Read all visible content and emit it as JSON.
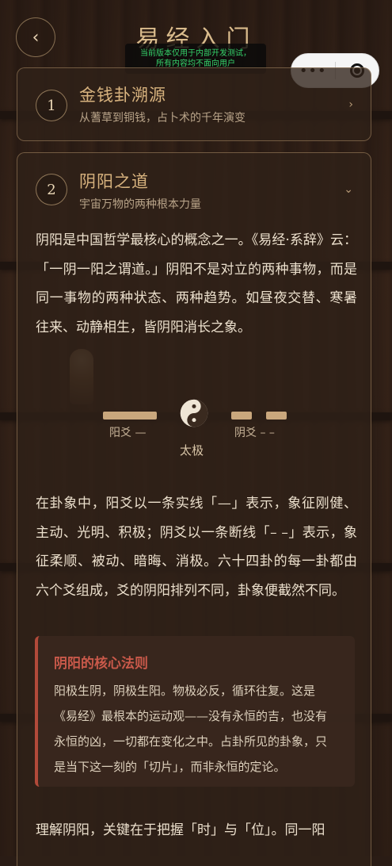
{
  "header": {
    "back_icon": "chevron-left-icon",
    "back_glyph": "‹",
    "title": "易经入门",
    "dev_tip_line1": "当前版本仅用于内部开发测试，",
    "dev_tip_line2": "所有内容均不面向用户",
    "capsule_more": "•••",
    "capsule_close_icon": "target-icon"
  },
  "sections": [
    {
      "number": "1",
      "title": "金钱卦溯源",
      "subtitle": "从蓍草到铜钱，占卜术的千年演变",
      "chevron": "›"
    },
    {
      "number": "2",
      "title": "阴阳之道",
      "subtitle": "宇宙万物的两种根本力量",
      "chevron": "⌄"
    }
  ],
  "content": {
    "paragraph1": "阴阳是中国哲学最核心的概念之一。《易经·系辞》云：「一阴一阳之谓道。」阴阳不是对立的两种事物，而是同一事物的两种状态、两种趋势。如昼夜交替、寒暑往来、动静相生，皆阴阳消长之象。",
    "diagram": {
      "yang_label": "阳爻 —",
      "yin_label": "阴爻 – –",
      "taiji_label": "太极"
    },
    "paragraph2": "在卦象中，阳爻以一条实线「—」表示，象征刚健、主动、光明、积极；阴爻以一条断线「– –」表示，象征柔顺、被动、暗晦、消极。六十四卦的每一卦都由六个爻组成，爻的阴阳排列不同，卦象便截然不同。",
    "rule_title": "阴阳的核心法则",
    "rule_text": "阳极生阴，阴极生阳。物极必反，循环往复。这是《易经》最根本的运动观——没有永恒的吉，也没有永恒的凶，一切都在变化之中。占卦所见的卦象，只是当下这一刻的「切片」，而非永恒的定论。",
    "paragraph3": "理解阴阳，关键在于把握「时」与「位」。同一阳"
  },
  "colors": {
    "accent_gold": "#d7b27e",
    "rule_red": "#b24a3a",
    "dev_tip_green": "#36d36b"
  }
}
